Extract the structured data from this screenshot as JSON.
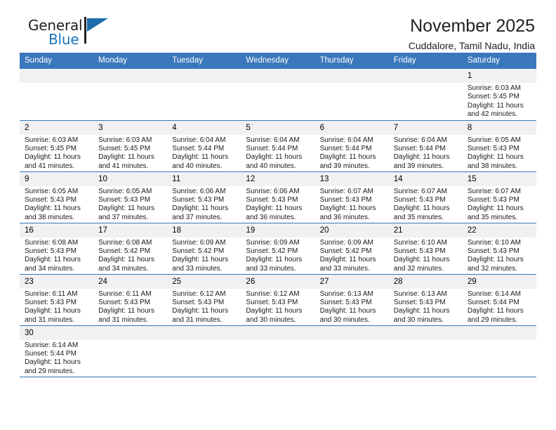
{
  "brand": {
    "name_part1": "General",
    "name_part2": "Blue"
  },
  "header": {
    "month_title": "November 2025",
    "location": "Cuddalore, Tamil Nadu, India"
  },
  "colors": {
    "header_blue": "#3b77bc",
    "brand_blue": "#1b75bb",
    "daynum_bg": "#f1f1f1",
    "text": "#1a1a1a"
  },
  "weekdays": [
    "Sunday",
    "Monday",
    "Tuesday",
    "Wednesday",
    "Thursday",
    "Friday",
    "Saturday"
  ],
  "weeks": [
    [
      {
        "day": "",
        "sunrise": "",
        "sunset": "",
        "daylight": "",
        "blank": true
      },
      {
        "day": "",
        "sunrise": "",
        "sunset": "",
        "daylight": "",
        "blank": true
      },
      {
        "day": "",
        "sunrise": "",
        "sunset": "",
        "daylight": "",
        "blank": true
      },
      {
        "day": "",
        "sunrise": "",
        "sunset": "",
        "daylight": "",
        "blank": true
      },
      {
        "day": "",
        "sunrise": "",
        "sunset": "",
        "daylight": "",
        "blank": true
      },
      {
        "day": "",
        "sunrise": "",
        "sunset": "",
        "daylight": "",
        "blank": true
      },
      {
        "day": "1",
        "sunrise": "Sunrise: 6:03 AM",
        "sunset": "Sunset: 5:45 PM",
        "daylight": "Daylight: 11 hours and 42 minutes.",
        "blank": false
      }
    ],
    [
      {
        "day": "2",
        "sunrise": "Sunrise: 6:03 AM",
        "sunset": "Sunset: 5:45 PM",
        "daylight": "Daylight: 11 hours and 41 minutes.",
        "blank": false
      },
      {
        "day": "3",
        "sunrise": "Sunrise: 6:03 AM",
        "sunset": "Sunset: 5:45 PM",
        "daylight": "Daylight: 11 hours and 41 minutes.",
        "blank": false
      },
      {
        "day": "4",
        "sunrise": "Sunrise: 6:04 AM",
        "sunset": "Sunset: 5:44 PM",
        "daylight": "Daylight: 11 hours and 40 minutes.",
        "blank": false
      },
      {
        "day": "5",
        "sunrise": "Sunrise: 6:04 AM",
        "sunset": "Sunset: 5:44 PM",
        "daylight": "Daylight: 11 hours and 40 minutes.",
        "blank": false
      },
      {
        "day": "6",
        "sunrise": "Sunrise: 6:04 AM",
        "sunset": "Sunset: 5:44 PM",
        "daylight": "Daylight: 11 hours and 39 minutes.",
        "blank": false
      },
      {
        "day": "7",
        "sunrise": "Sunrise: 6:04 AM",
        "sunset": "Sunset: 5:44 PM",
        "daylight": "Daylight: 11 hours and 39 minutes.",
        "blank": false
      },
      {
        "day": "8",
        "sunrise": "Sunrise: 6:05 AM",
        "sunset": "Sunset: 5:43 PM",
        "daylight": "Daylight: 11 hours and 38 minutes.",
        "blank": false
      }
    ],
    [
      {
        "day": "9",
        "sunrise": "Sunrise: 6:05 AM",
        "sunset": "Sunset: 5:43 PM",
        "daylight": "Daylight: 11 hours and 38 minutes.",
        "blank": false
      },
      {
        "day": "10",
        "sunrise": "Sunrise: 6:05 AM",
        "sunset": "Sunset: 5:43 PM",
        "daylight": "Daylight: 11 hours and 37 minutes.",
        "blank": false
      },
      {
        "day": "11",
        "sunrise": "Sunrise: 6:06 AM",
        "sunset": "Sunset: 5:43 PM",
        "daylight": "Daylight: 11 hours and 37 minutes.",
        "blank": false
      },
      {
        "day": "12",
        "sunrise": "Sunrise: 6:06 AM",
        "sunset": "Sunset: 5:43 PM",
        "daylight": "Daylight: 11 hours and 36 minutes.",
        "blank": false
      },
      {
        "day": "13",
        "sunrise": "Sunrise: 6:07 AM",
        "sunset": "Sunset: 5:43 PM",
        "daylight": "Daylight: 11 hours and 36 minutes.",
        "blank": false
      },
      {
        "day": "14",
        "sunrise": "Sunrise: 6:07 AM",
        "sunset": "Sunset: 5:43 PM",
        "daylight": "Daylight: 11 hours and 35 minutes.",
        "blank": false
      },
      {
        "day": "15",
        "sunrise": "Sunrise: 6:07 AM",
        "sunset": "Sunset: 5:43 PM",
        "daylight": "Daylight: 11 hours and 35 minutes.",
        "blank": false
      }
    ],
    [
      {
        "day": "16",
        "sunrise": "Sunrise: 6:08 AM",
        "sunset": "Sunset: 5:43 PM",
        "daylight": "Daylight: 11 hours and 34 minutes.",
        "blank": false
      },
      {
        "day": "17",
        "sunrise": "Sunrise: 6:08 AM",
        "sunset": "Sunset: 5:42 PM",
        "daylight": "Daylight: 11 hours and 34 minutes.",
        "blank": false
      },
      {
        "day": "18",
        "sunrise": "Sunrise: 6:09 AM",
        "sunset": "Sunset: 5:42 PM",
        "daylight": "Daylight: 11 hours and 33 minutes.",
        "blank": false
      },
      {
        "day": "19",
        "sunrise": "Sunrise: 6:09 AM",
        "sunset": "Sunset: 5:42 PM",
        "daylight": "Daylight: 11 hours and 33 minutes.",
        "blank": false
      },
      {
        "day": "20",
        "sunrise": "Sunrise: 6:09 AM",
        "sunset": "Sunset: 5:42 PM",
        "daylight": "Daylight: 11 hours and 33 minutes.",
        "blank": false
      },
      {
        "day": "21",
        "sunrise": "Sunrise: 6:10 AM",
        "sunset": "Sunset: 5:43 PM",
        "daylight": "Daylight: 11 hours and 32 minutes.",
        "blank": false
      },
      {
        "day": "22",
        "sunrise": "Sunrise: 6:10 AM",
        "sunset": "Sunset: 5:43 PM",
        "daylight": "Daylight: 11 hours and 32 minutes.",
        "blank": false
      }
    ],
    [
      {
        "day": "23",
        "sunrise": "Sunrise: 6:11 AM",
        "sunset": "Sunset: 5:43 PM",
        "daylight": "Daylight: 11 hours and 31 minutes.",
        "blank": false
      },
      {
        "day": "24",
        "sunrise": "Sunrise: 6:11 AM",
        "sunset": "Sunset: 5:43 PM",
        "daylight": "Daylight: 11 hours and 31 minutes.",
        "blank": false
      },
      {
        "day": "25",
        "sunrise": "Sunrise: 6:12 AM",
        "sunset": "Sunset: 5:43 PM",
        "daylight": "Daylight: 11 hours and 31 minutes.",
        "blank": false
      },
      {
        "day": "26",
        "sunrise": "Sunrise: 6:12 AM",
        "sunset": "Sunset: 5:43 PM",
        "daylight": "Daylight: 11 hours and 30 minutes.",
        "blank": false
      },
      {
        "day": "27",
        "sunrise": "Sunrise: 6:13 AM",
        "sunset": "Sunset: 5:43 PM",
        "daylight": "Daylight: 11 hours and 30 minutes.",
        "blank": false
      },
      {
        "day": "28",
        "sunrise": "Sunrise: 6:13 AM",
        "sunset": "Sunset: 5:43 PM",
        "daylight": "Daylight: 11 hours and 30 minutes.",
        "blank": false
      },
      {
        "day": "29",
        "sunrise": "Sunrise: 6:14 AM",
        "sunset": "Sunset: 5:44 PM",
        "daylight": "Daylight: 11 hours and 29 minutes.",
        "blank": false
      }
    ],
    [
      {
        "day": "30",
        "sunrise": "Sunrise: 6:14 AM",
        "sunset": "Sunset: 5:44 PM",
        "daylight": "Daylight: 11 hours and 29 minutes.",
        "blank": false
      },
      {
        "day": "",
        "sunrise": "",
        "sunset": "",
        "daylight": "",
        "blank": true
      },
      {
        "day": "",
        "sunrise": "",
        "sunset": "",
        "daylight": "",
        "blank": true
      },
      {
        "day": "",
        "sunrise": "",
        "sunset": "",
        "daylight": "",
        "blank": true
      },
      {
        "day": "",
        "sunrise": "",
        "sunset": "",
        "daylight": "",
        "blank": true
      },
      {
        "day": "",
        "sunrise": "",
        "sunset": "",
        "daylight": "",
        "blank": true
      },
      {
        "day": "",
        "sunrise": "",
        "sunset": "",
        "daylight": "",
        "blank": true
      }
    ]
  ]
}
